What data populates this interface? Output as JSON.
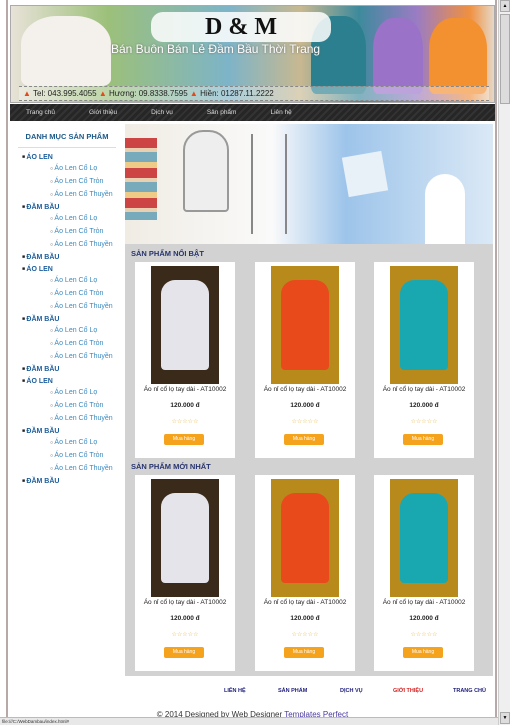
{
  "header": {
    "logo": "D & M",
    "slogan": "Bán Buôn Bán Lẻ Đầm Bầu Thời Trang",
    "contacts": [
      "Tel: 043.995.4055",
      "Hương: 09.8338.7595",
      "Hiền: 01287.11.2222"
    ]
  },
  "nav": [
    "Trang chủ",
    "Giới thiệu",
    "Dịch vụ",
    "Sản phẩm",
    "Liên hệ"
  ],
  "sidebar": {
    "title": "DANH MỤC SẢN PHẨM",
    "categories": [
      {
        "label": "ÁO LEN",
        "sub": [
          "Áo Len Cổ Lọ",
          "Áo Len Cổ Tròn",
          "Áo Len Cổ Thuyền"
        ]
      },
      {
        "label": "ĐẦM BẦU",
        "sub": [
          "Áo Len Cổ Lọ",
          "Áo Len Cổ Tròn",
          "Áo Len Cổ Thuyền"
        ]
      },
      {
        "label": "ĐẦM BẦU",
        "sub": []
      },
      {
        "label": "ÁO LEN",
        "sub": [
          "Áo Len Cổ Lọ",
          "Áo Len Cổ Tròn",
          "Áo Len Cổ Thuyền"
        ]
      },
      {
        "label": "ĐẦM BẦU",
        "sub": [
          "Áo Len Cổ Lọ",
          "Áo Len Cổ Tròn",
          "Áo Len Cổ Thuyền"
        ]
      },
      {
        "label": "ĐẦM BẦU",
        "sub": []
      },
      {
        "label": "ÁO LEN",
        "sub": [
          "Áo Len Cổ Lọ",
          "Áo Len Cổ Tròn",
          "Áo Len Cổ Thuyền"
        ]
      },
      {
        "label": "ĐẦM BẦU",
        "sub": [
          "Áo Len Cổ Lọ",
          "Áo Len Cổ Tròn",
          "Áo Len Cổ Thuyền"
        ]
      },
      {
        "label": "ĐẦM BẦU",
        "sub": []
      }
    ]
  },
  "sections": [
    {
      "title": "SẢN PHẨM NỔI BẬT",
      "products": [
        {
          "name": "Áo nỉ cổ lọ tay dài - AT10002",
          "price": "120.000 đ",
          "rating": 0,
          "buy": "Mua hàng",
          "color": "#e4e4ea",
          "bg": "#3a2a1a"
        },
        {
          "name": "Áo nỉ cổ lọ tay dài - AT10002",
          "price": "120.000 đ",
          "rating": 0,
          "buy": "Mua hàng",
          "color": "#e84a1c",
          "bg": "#b88a1c"
        },
        {
          "name": "Áo nỉ cổ lọ tay dài - AT10002",
          "price": "120.000 đ",
          "rating": 0,
          "buy": "Mua hàng",
          "color": "#1aa8b0",
          "bg": "#b88a1c"
        }
      ]
    },
    {
      "title": "SẢN PHẨM MỚI NHẤT",
      "products": [
        {
          "name": "Áo nỉ cổ lọ tay dài - AT10002",
          "price": "120.000 đ",
          "rating": 0,
          "buy": "Mua hàng",
          "color": "#e4e4ea",
          "bg": "#3a2a1a"
        },
        {
          "name": "Áo nỉ cổ lọ tay dài - AT10002",
          "price": "120.000 đ",
          "rating": 0,
          "buy": "Mua hàng",
          "color": "#e84a1c",
          "bg": "#b88a1c"
        },
        {
          "name": "Áo nỉ cổ lọ tay dài - AT10002",
          "price": "120.000 đ",
          "rating": 0,
          "buy": "Mua hàng",
          "color": "#1aa8b0",
          "bg": "#b88a1c"
        }
      ]
    }
  ],
  "footer": {
    "links": [
      {
        "label": "LIÊN HỆ",
        "color": "#1d1d7a"
      },
      {
        "label": "SẢN PHẨM",
        "color": "#1d1d7a"
      },
      {
        "label": "DỊCH VỤ",
        "color": "#1d1d7a"
      },
      {
        "label": "GIỚI THIỆU",
        "color": "#d42020"
      },
      {
        "label": "TRANG CHỦ",
        "color": "#1d1d7a"
      }
    ],
    "copyright": "© 2014 Designed by Web Designer",
    "copyright_link": "Templates Perfect"
  },
  "status_bar": "file:///C:/WebDambau/index.html#"
}
